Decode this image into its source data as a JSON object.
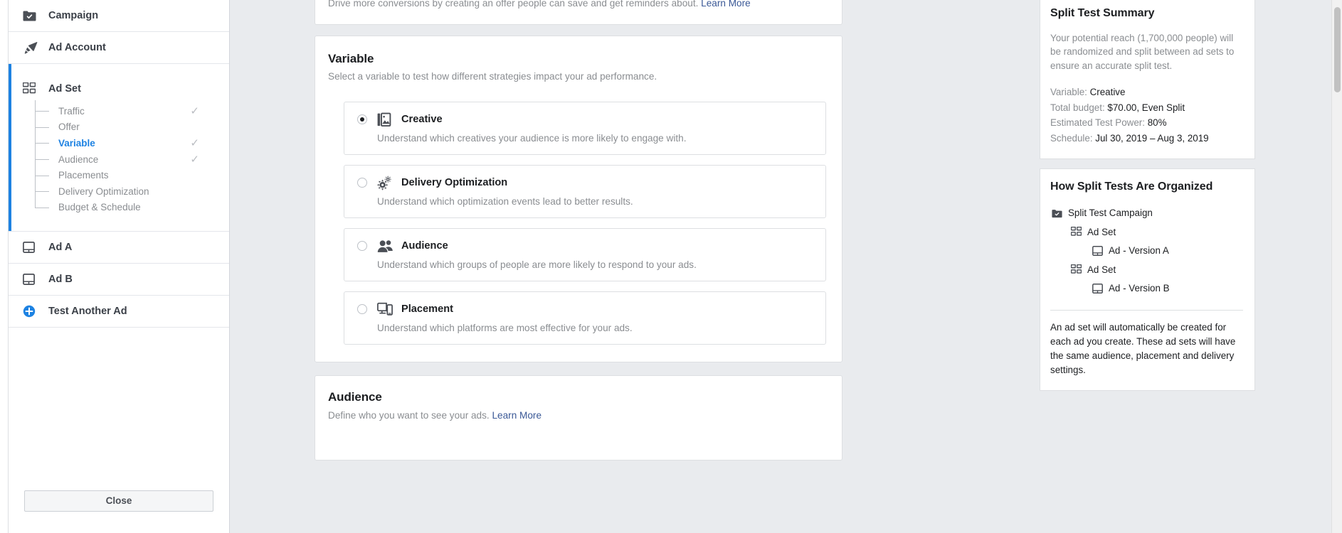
{
  "sidebar": {
    "campaign": {
      "label": "Campaign",
      "icon": "campaign-check-icon"
    },
    "ad_account": {
      "label": "Ad Account",
      "icon": "megaphone-icon"
    },
    "ad_set": {
      "label": "Ad Set",
      "icon": "grid-squares-icon",
      "items": [
        {
          "label": "Traffic",
          "checked": true,
          "active": false
        },
        {
          "label": "Offer",
          "checked": false,
          "active": false
        },
        {
          "label": "Variable",
          "checked": true,
          "active": true
        },
        {
          "label": "Audience",
          "checked": true,
          "active": false
        },
        {
          "label": "Placements",
          "checked": false,
          "active": false
        },
        {
          "label": "Delivery Optimization",
          "checked": false,
          "active": false
        },
        {
          "label": "Budget & Schedule",
          "checked": false,
          "active": false
        }
      ]
    },
    "ads": [
      {
        "label": "Ad A",
        "icon": "ad-window-icon"
      },
      {
        "label": "Ad B",
        "icon": "ad-window-icon"
      }
    ],
    "test_another_ad": {
      "label": "Test Another Ad",
      "icon": "plus-circle-icon"
    },
    "close_button": "Close"
  },
  "offer_card": {
    "text": "Drive more conversions by creating an offer people can save and get reminders about.",
    "link": "Learn More"
  },
  "variable_section": {
    "title": "Variable",
    "subtitle": "Select a variable to test how different strategies impact your ad performance.",
    "options": [
      {
        "id": "creative",
        "title": "Creative",
        "description": "Understand which creatives your audience is more likely to engage with.",
        "icon": "image-stack-icon",
        "selected": true
      },
      {
        "id": "delivery-optimization",
        "title": "Delivery Optimization",
        "description": "Understand which optimization events lead to better results.",
        "icon": "gears-icon",
        "selected": false
      },
      {
        "id": "audience",
        "title": "Audience",
        "description": "Understand which groups of people are more likely to respond to your ads.",
        "icon": "people-icon",
        "selected": false
      },
      {
        "id": "placement",
        "title": "Placement",
        "description": "Understand which platforms are most effective for your ads.",
        "icon": "devices-icon",
        "selected": false
      }
    ]
  },
  "audience_section": {
    "title": "Audience",
    "subtitle": "Define who you want to see your ads.",
    "link": "Learn More"
  },
  "summary_panel": {
    "title": "Split Test Summary",
    "paragraph": "Your potential reach (1,700,000 people) will be randomized and split between ad sets to ensure an accurate split test.",
    "rows": [
      {
        "label": "Variable: ",
        "value": "Creative"
      },
      {
        "label": "Total budget: ",
        "value": "$70.00, Even Split"
      },
      {
        "label": "Estimated Test Power: ",
        "value": "80%"
      },
      {
        "label": "Schedule: ",
        "value": "Jul 30, 2019 – Aug 3, 2019"
      }
    ]
  },
  "organized_panel": {
    "title": "How Split Tests Are Organized",
    "tree": [
      {
        "label": "Split Test Campaign",
        "level": 1,
        "icon": "campaign-check-icon"
      },
      {
        "label": "Ad Set",
        "level": 2,
        "icon": "grid-squares-icon"
      },
      {
        "label": "Ad - Version A",
        "level": 3,
        "icon": "ad-window-icon"
      },
      {
        "label": "Ad Set",
        "level": 2,
        "icon": "grid-squares-icon"
      },
      {
        "label": "Ad - Version B",
        "level": 3,
        "icon": "ad-window-icon"
      }
    ],
    "footnote": "An ad set will automatically be created for each ad you create. These ad sets will have the same audience, placement and delivery settings."
  },
  "colors": {
    "accent_blue": "#1d82e2",
    "link_blue": "#3a5896",
    "muted_text": "#8a8d91",
    "dark_text": "#1c1e21",
    "page_bg": "#e9ebee"
  }
}
